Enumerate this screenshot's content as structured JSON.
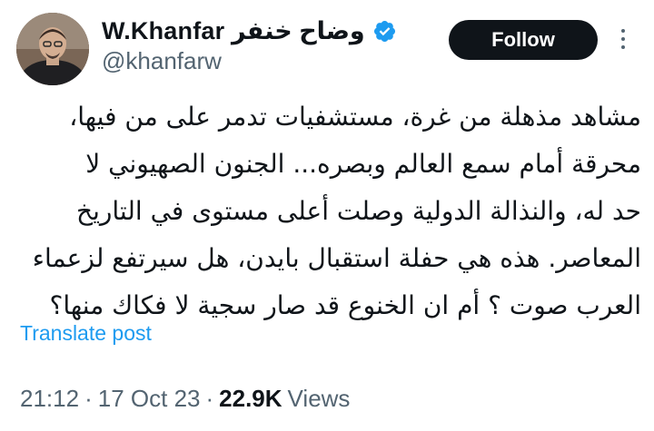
{
  "author": {
    "display_name": "W.Khanfar وضاح خنفر",
    "handle": "@khanfarw",
    "verified_icon": "verified-badge-icon",
    "avatar_icon": "profile-photo"
  },
  "actions": {
    "follow_label": "Follow",
    "more_icon": "more-options-icon"
  },
  "tweet": {
    "lines": [
      "مشاهد مذهلة من غرة، مستشفيات تدمر على من فيها،",
      "محرقة أمام سمع العالم وبصره... الجنون الصهيوني لا",
      "حد له، والنذالة الدولية وصلت أعلى مستوى في التاريخ",
      "المعاصر. هذه هي حفلة استقبال بايدن، هل سيرتفع لزعماء",
      "العرب صوت ؟ أم ان الخنوع قد صار سجية لا فكاك منها؟"
    ],
    "translate_label": "Translate post"
  },
  "meta": {
    "time": "21:12",
    "separator": "·",
    "date": "17 Oct 23",
    "views_count": "22.9K",
    "views_label": "Views"
  },
  "colors": {
    "link": "#1d9bf0",
    "secondary_text": "#536471",
    "primary_text": "#0f1419",
    "verified": "#1d9bf0",
    "follow_bg": "#0f1419"
  }
}
